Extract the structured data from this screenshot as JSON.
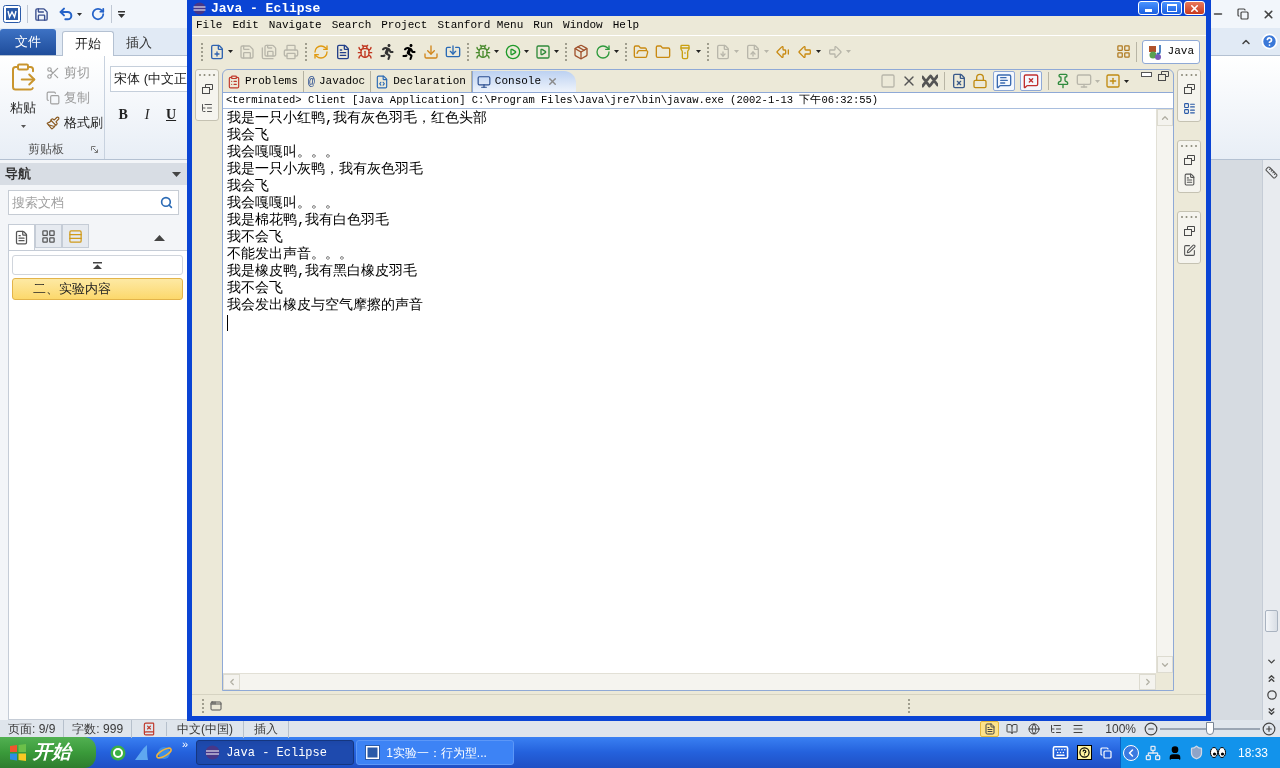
{
  "word": {
    "ribbon_tabs": [
      {
        "label": "文件",
        "kind": "backstage",
        "selected": false
      },
      {
        "label": "开始",
        "kind": "tab",
        "selected": true
      },
      {
        "label": "插入",
        "kind": "tab",
        "selected": false
      }
    ],
    "clipboard": {
      "paste": "粘贴",
      "tools": [
        {
          "label": "剪切",
          "kind": "cut",
          "disabled": true
        },
        {
          "label": "复制",
          "kind": "copy",
          "disabled": true
        },
        {
          "label": "格式刷",
          "kind": "format_painter",
          "disabled": false
        }
      ],
      "group_label": "剪贴板"
    },
    "font": {
      "name": "宋体 (中文正",
      "styles": [
        {
          "label": "B",
          "kind": "bold"
        },
        {
          "label": "I",
          "kind": "italic"
        },
        {
          "label": "U",
          "kind": "underline"
        }
      ]
    },
    "navigation": {
      "title": "导航",
      "search": {
        "placeholder": "搜索文档"
      },
      "view_tabs": [
        {
          "kind": "headings",
          "selected": true
        },
        {
          "kind": "pages",
          "selected": false
        },
        {
          "kind": "results",
          "selected": false
        }
      ],
      "headings": [
        {
          "label": "二、实验内容",
          "selected": true
        }
      ]
    },
    "status_bar": {
      "page": "页面: 9/9",
      "words": "字数: 999",
      "language": "中文(中国)",
      "mode": "插入",
      "views": [
        {
          "kind": "print",
          "selected": true
        },
        {
          "kind": "reading",
          "selected": false
        },
        {
          "kind": "web",
          "selected": false
        },
        {
          "kind": "outline",
          "selected": false
        },
        {
          "kind": "draft",
          "selected": false
        }
      ],
      "zoom": "100%",
      "zoom_slider": {
        "level": 0.5
      }
    }
  },
  "eclipse": {
    "title": "Java - Eclipse",
    "menu": [
      "File",
      "Edit",
      "Navigate",
      "Search",
      "Project",
      "Stanford Menu",
      "Run",
      "Window",
      "Help"
    ],
    "toolbar": [
      [
        {
          "kind": "new",
          "dropdown": true,
          "disabled": false
        },
        {
          "kind": "save",
          "dropdown": false,
          "disabled": true
        },
        {
          "kind": "save_all",
          "dropdown": false,
          "disabled": true
        },
        {
          "kind": "print",
          "dropdown": false,
          "disabled": true
        }
      ],
      [
        {
          "kind": "swap",
          "dropdown": false,
          "disabled": false
        },
        {
          "kind": "document",
          "dropdown": false,
          "disabled": false
        },
        {
          "kind": "bug_box",
          "dropdown": false,
          "disabled": false
        },
        {
          "kind": "runner_outline",
          "dropdown": false,
          "disabled": false
        },
        {
          "kind": "runner",
          "dropdown": false,
          "disabled": false
        },
        {
          "kind": "tray_down",
          "dropdown": false,
          "disabled": false
        },
        {
          "kind": "tray_import",
          "dropdown": false,
          "disabled": false
        }
      ],
      [
        {
          "kind": "debug",
          "dropdown": true,
          "disabled": false
        },
        {
          "kind": "run",
          "dropdown": true,
          "disabled": false
        },
        {
          "kind": "external_tools",
          "dropdown": true,
          "disabled": false
        }
      ],
      [
        {
          "kind": "new_package",
          "dropdown": false,
          "disabled": false
        },
        {
          "kind": "new_class",
          "dropdown": true,
          "disabled": false
        }
      ],
      [
        {
          "kind": "open_type",
          "dropdown": false,
          "disabled": false
        },
        {
          "kind": "open_folder",
          "dropdown": false,
          "disabled": false
        },
        {
          "kind": "search",
          "dropdown": true,
          "disabled": false
        }
      ],
      [
        {
          "kind": "next_annotation",
          "dropdown": true,
          "disabled": true
        },
        {
          "kind": "prev_annotation",
          "dropdown": true,
          "disabled": true
        },
        {
          "kind": "last_edit",
          "dropdown": false,
          "disabled": false
        },
        {
          "kind": "back",
          "dropdown": true,
          "disabled": false
        },
        {
          "kind": "forward",
          "dropdown": true,
          "disabled": true
        }
      ]
    ],
    "perspectives": [
      {
        "label": "Java",
        "selected": true
      }
    ],
    "console": {
      "tabs": [
        {
          "label": "Problems",
          "kind": "problems",
          "selected": false
        },
        {
          "label": "Javadoc",
          "kind": "javadoc",
          "glyph": "@",
          "selected": false
        },
        {
          "label": "Declaration",
          "kind": "declaration",
          "selected": false
        },
        {
          "label": "Console",
          "kind": "console",
          "selected": true
        }
      ],
      "actions": [
        [
          {
            "kind": "terminate",
            "disabled": true,
            "pressed": false,
            "dropdown": false
          },
          {
            "kind": "remove_launch",
            "disabled": false,
            "pressed": false,
            "dropdown": false
          },
          {
            "kind": "remove_all",
            "disabled": false,
            "pressed": false,
            "dropdown": false
          }
        ],
        [
          {
            "kind": "clear",
            "disabled": false,
            "pressed": false,
            "dropdown": false
          },
          {
            "kind": "scroll_lock",
            "disabled": false,
            "pressed": false,
            "dropdown": false
          },
          {
            "kind": "stdout",
            "disabled": false,
            "pressed": true,
            "dropdown": false
          },
          {
            "kind": "stderr",
            "disabled": false,
            "pressed": true,
            "dropdown": false
          }
        ],
        [
          {
            "kind": "pin",
            "disabled": false,
            "pressed": false,
            "dropdown": false
          },
          {
            "kind": "display",
            "disabled": true,
            "pressed": false,
            "dropdown": true
          },
          {
            "kind": "open",
            "disabled": false,
            "pressed": false,
            "dropdown": true
          }
        ]
      ],
      "description": "<terminated> Client [Java Application] C:\\Program Files\\Java\\jre7\\bin\\javaw.exe (2002-1-13 下午06:32:55)",
      "lines": [
        "我是一只小红鸭,我有灰色羽毛，红色头部",
        "我会飞",
        "我会嘎嘎叫。。。",
        "我是一只小灰鸭，我有灰色羽毛",
        "我会飞",
        "我会嘎嘎叫。。。",
        "我是棉花鸭,我有白色羽毛",
        "我不会飞",
        "不能发出声音。。。",
        "我是橡皮鸭,我有黑白橡皮羽毛",
        "我不会飞",
        "我会发出橡皮与空气摩擦的声音"
      ]
    }
  },
  "taskbar": {
    "start": "开始",
    "more": "»",
    "tasks": [
      {
        "label": "Java - Eclipse",
        "kind": "eclipse",
        "selected": true
      },
      {
        "label": "1实验一：行为型...",
        "kind": "word",
        "selected": false
      }
    ],
    "clock": "18:33"
  }
}
